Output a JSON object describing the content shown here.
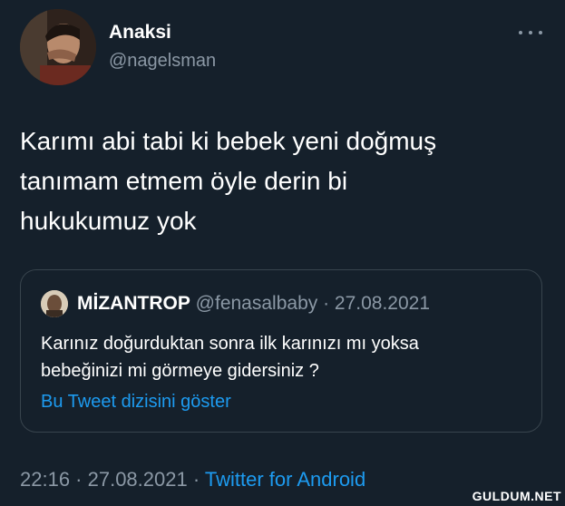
{
  "author": {
    "name": "Anaksi",
    "handle": "@nagelsman"
  },
  "tweet": {
    "lines": [
      "Karımı abi tabi ki bebek yeni doğmuş",
      "tanımam etmem öyle derin bi",
      "hukukumuz yok"
    ]
  },
  "quote": {
    "name": "MİZANTROP",
    "meta": "@fenasalbaby · 27.08.2021",
    "lines": [
      "Karınız doğurduktan sonra ilk karınızı mı yoksa",
      "bebeğinizi mi görmeye gidersiniz ?"
    ],
    "show_thread": "Bu Tweet dizisini göster"
  },
  "footer": {
    "time_date": "22:16 · 27.08.2021 · ",
    "source": "Twitter for Android"
  },
  "watermark": "GULDUM.NET",
  "icons": {
    "more": "more-horizontal-icon"
  },
  "colors": {
    "background": "#15202b",
    "text": "#ffffff",
    "muted": "#8b98a5",
    "link": "#1d9bf0",
    "border": "#38444d"
  }
}
